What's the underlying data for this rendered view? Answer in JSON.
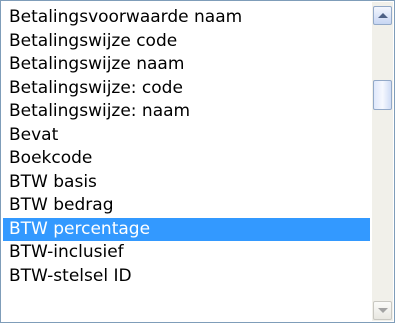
{
  "listbox": {
    "items": [
      {
        "label": "Betalingsvoorwaarde naam",
        "selected": false
      },
      {
        "label": "Betalingswijze code",
        "selected": false
      },
      {
        "label": "Betalingswijze naam",
        "selected": false
      },
      {
        "label": "Betalingswijze: code",
        "selected": false
      },
      {
        "label": "Betalingswijze: naam",
        "selected": false
      },
      {
        "label": "Bevat",
        "selected": false
      },
      {
        "label": "Boekcode",
        "selected": false
      },
      {
        "label": "BTW basis",
        "selected": false
      },
      {
        "label": "BTW bedrag",
        "selected": false
      },
      {
        "label": "BTW percentage",
        "selected": true
      },
      {
        "label": "BTW-inclusief",
        "selected": false
      },
      {
        "label": "BTW-stelsel ID",
        "selected": false
      }
    ],
    "selected_color": "#3399ff"
  },
  "scrollbar": {
    "up_icon": "scroll-up-arrow-icon",
    "down_icon": "scroll-down-arrow-icon"
  }
}
